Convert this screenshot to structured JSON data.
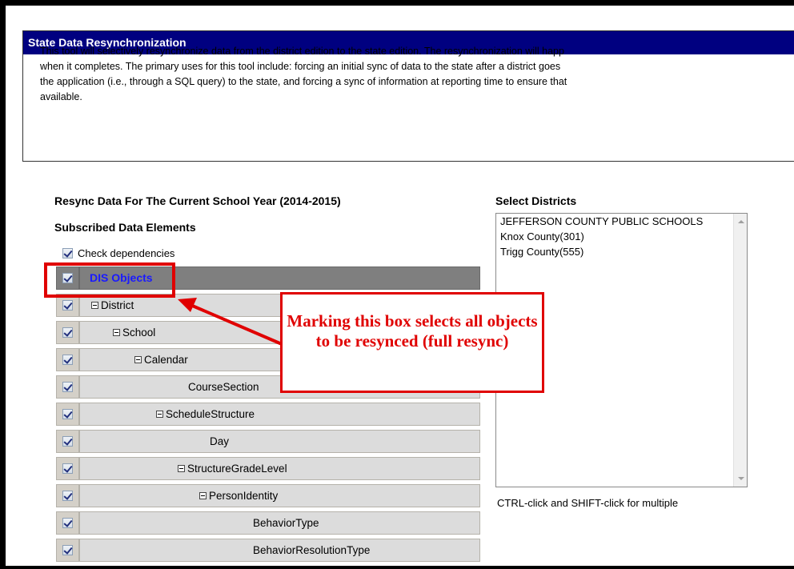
{
  "panel": {
    "title": "State Data Resynchronization",
    "description": "This tool will selectively resynchronize data from the district edition to the state edition. The resynchronization will happ\nwhen it completes. The primary uses for this tool include: forcing an initial sync of data to the state after a district goes\nthe application (i.e., through a SQL query) to the state, and forcing a sync of information at reporting time to ensure that\navailable."
  },
  "resync": {
    "title": "Resync Data For The Current School Year (2014-2015)",
    "subscribed_title": "Subscribed Data Elements",
    "check_dependencies_label": "Check dependencies",
    "check_dependencies_checked": true
  },
  "tree": [
    {
      "label": "DIS Objects",
      "indent": 0,
      "toggle": false,
      "header": true,
      "checked": true
    },
    {
      "label": "District",
      "indent": 0,
      "toggle": true,
      "header": false,
      "checked": true
    },
    {
      "label": "School",
      "indent": 1,
      "toggle": true,
      "header": false,
      "checked": true
    },
    {
      "label": "Calendar",
      "indent": 2,
      "toggle": true,
      "header": false,
      "checked": true
    },
    {
      "label": "CourseSection",
      "indent": 3,
      "toggle": false,
      "header": false,
      "checked": true
    },
    {
      "label": "ScheduleStructure",
      "indent": 3,
      "toggle": true,
      "header": false,
      "checked": true
    },
    {
      "label": "Day",
      "indent": 4,
      "toggle": false,
      "header": false,
      "checked": true
    },
    {
      "label": "StructureGradeLevel",
      "indent": 4,
      "toggle": true,
      "header": false,
      "checked": true
    },
    {
      "label": "PersonIdentity",
      "indent": 5,
      "toggle": true,
      "header": false,
      "checked": true
    },
    {
      "label": "BehaviorType",
      "indent": 6,
      "toggle": false,
      "header": false,
      "checked": true
    },
    {
      "label": "BehaviorResolutionType",
      "indent": 6,
      "toggle": false,
      "header": false,
      "checked": true
    }
  ],
  "districts": {
    "title": "Select Districts",
    "options": [
      "JEFFERSON COUNTY PUBLIC SCHOOLS",
      "Knox County(301)",
      "Trigg County(555)"
    ],
    "hint": "CTRL-click and SHIFT-click for multiple"
  },
  "callout": {
    "text": "Marking this box selects all objects to be resynced (full resync)"
  },
  "colors": {
    "header_bg": "#000080",
    "callout_red": "#e00000",
    "tree_header_text": "#1a1aff"
  }
}
